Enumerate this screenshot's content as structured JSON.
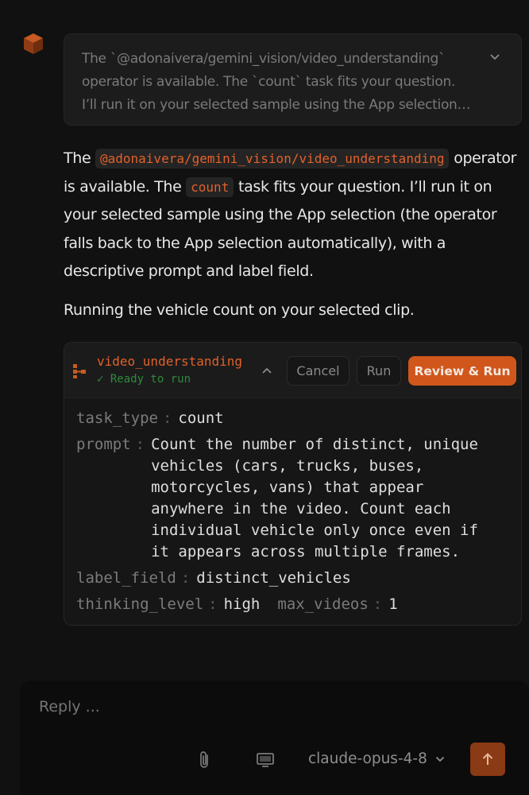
{
  "thinking": {
    "preview": "The `@adonaivera/gemini_vision/video_understanding` operator is available. The `count` task fits your question. I’ll run it on your selected sample using the App selection (the operator falls back to the App selection automatically), with a descriptive prompt and label field."
  },
  "message": {
    "p1_the": "The",
    "p1_operator_code": "@adonaivera/gemini_vision/video_understanding",
    "p1_mid": "operator is available. The",
    "p1_task_code": "count",
    "p1_rest": "task fits your question. I’ll run it on your selected sample using the App selection (the operator falls back to the App selection automatically), with a descriptive prompt and label field.",
    "p2": "Running the vehicle count on your selected clip."
  },
  "operator_card": {
    "name": "video_understanding",
    "status": "✓ Ready to run",
    "cancel_label": "Cancel",
    "run_label": "Run",
    "review_run_label": "Review & Run",
    "params": {
      "task_type_key": "task_type",
      "task_type_val": "count",
      "prompt_key": "prompt",
      "prompt_val": "Count the number of distinct, unique vehicles (cars, trucks, buses, motorcycles, vans) that appear anywhere in the video. Count each individual vehicle only once even if it appears across multiple frames.",
      "label_field_key": "label_field",
      "label_field_val": "distinct_vehicles",
      "thinking_level_key": "thinking_level",
      "thinking_level_val": "high",
      "max_videos_key": "max_videos",
      "max_videos_val": "1",
      "separator": ":"
    }
  },
  "composer": {
    "placeholder": "Reply ...",
    "model": "claude-opus-4-8"
  },
  "colors": {
    "accent": "#d0561c",
    "code": "#e2612a",
    "ready": "#2e8b3e",
    "background": "#111111"
  },
  "icons": {
    "avatar": "cube-icon",
    "thinking_toggle": "chevron-down-icon",
    "operator": "operator-tree-icon",
    "collapse": "chevron-up-icon",
    "attach": "paperclip-icon",
    "screen": "monitor-icon",
    "model_dropdown": "chevron-down-icon",
    "send": "arrow-up-icon"
  }
}
